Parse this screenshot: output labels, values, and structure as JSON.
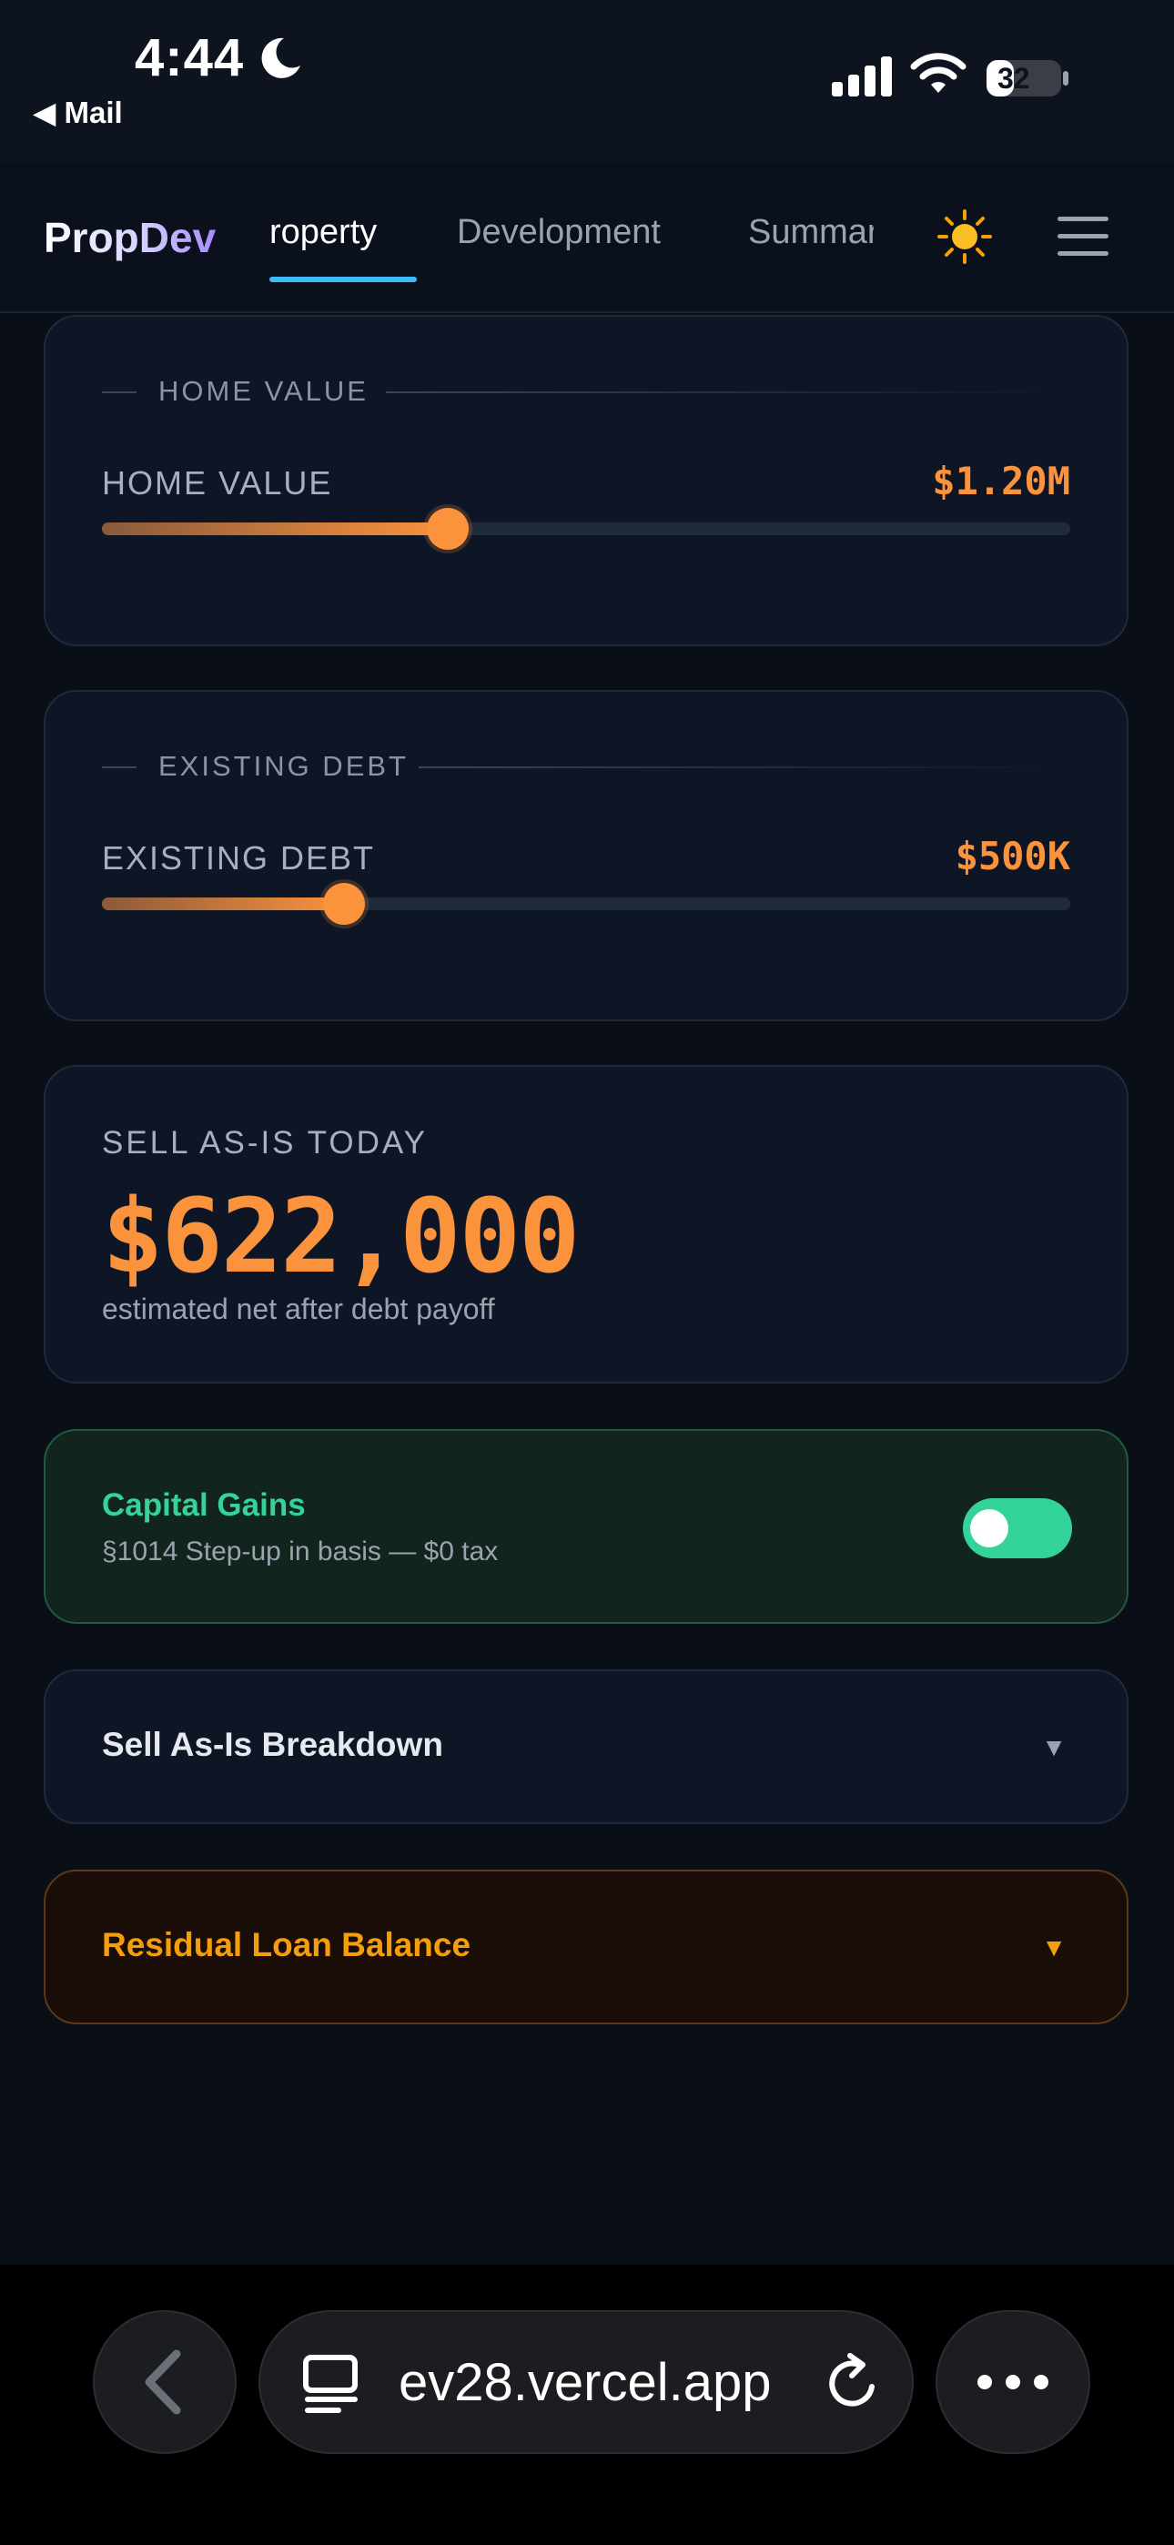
{
  "status_bar": {
    "time": "4:44",
    "back_app": "◀ Mail",
    "battery": "32"
  },
  "nav": {
    "logo": "PropDev",
    "tabs": [
      {
        "label": "roperty",
        "active": true
      },
      {
        "label": "Development",
        "active": false
      },
      {
        "label": "Summar",
        "active": false
      }
    ],
    "theme_icon": "sun-icon",
    "menu_icon": "hamburger-menu-icon"
  },
  "home_value": {
    "section_title": "HOME VALUE",
    "label": "HOME VALUE",
    "value": "$1.20M",
    "slider_fraction": 0.357
  },
  "existing_debt": {
    "section_title": "EXISTING DEBT",
    "label": "EXISTING DEBT",
    "value": "$500K",
    "slider_fraction": 0.25
  },
  "sell_as_is": {
    "label": "SELL AS-IS TODAY",
    "amount": "$622,000",
    "subtext": "estimated net after debt payoff"
  },
  "capital_gains": {
    "title": "Capital Gains",
    "subtitle": "§1014 Step-up in basis — $0 tax",
    "toggle_on": true
  },
  "accordions": {
    "breakdown": {
      "title": "Sell As-Is Breakdown",
      "chevron": "▼"
    },
    "residual_loan": {
      "title": "Residual Loan Balance",
      "chevron": "▼"
    }
  },
  "browser": {
    "url": "ev28.vercel.app"
  },
  "colors": {
    "accent_orange": "#fb923c",
    "accent_green": "#34d399",
    "tab_underline": "#38bdf8"
  }
}
